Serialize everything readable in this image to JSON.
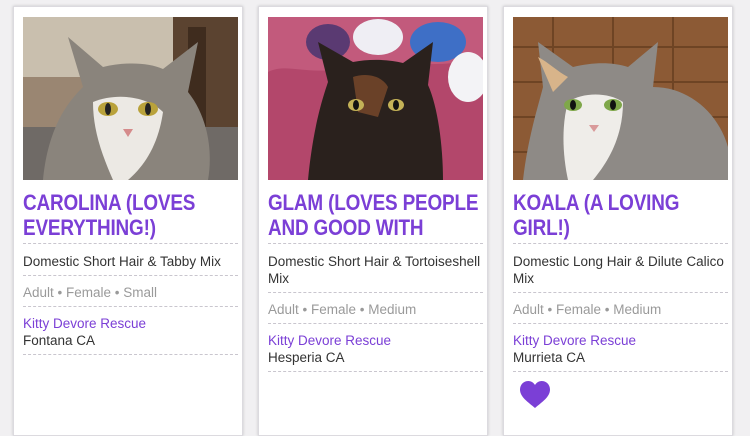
{
  "pets": [
    {
      "name": "Carolina (Loves Everything!)",
      "breed": "Domestic Short Hair & Tabby Mix",
      "details": "Adult • Female • Small",
      "organization": "Kitty Devore Rescue",
      "location": "Fontana CA",
      "favorite": false
    },
    {
      "name": "Glam (Loves People and Good With",
      "breed": "Domestic Short Hair & Tortoiseshell Mix",
      "details": "Adult • Female • Medium",
      "organization": "Kitty Devore Rescue",
      "location": "Hesperia CA",
      "favorite": false
    },
    {
      "name": "Koala (A Loving Girl!)",
      "breed": "Domestic Long Hair & Dilute Calico Mix",
      "details": "Adult • Female • Medium",
      "organization": "Kitty Devore Rescue",
      "location": "Murrieta CA",
      "favorite": true
    }
  ],
  "colors": {
    "accent": "#7b3fd6",
    "heart": "#7b3fd6",
    "background": "#f1f0f2"
  }
}
